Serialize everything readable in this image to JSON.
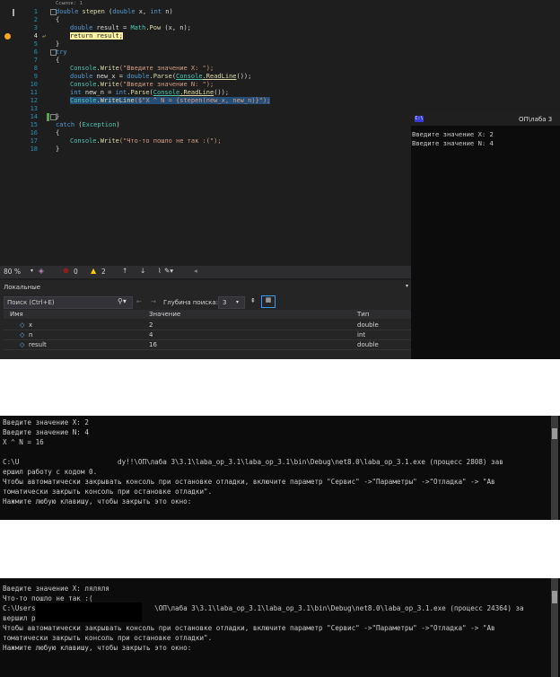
{
  "editor": {
    "codelens": "Ссылок: 1",
    "lines": [
      {
        "n": "1"
      },
      {
        "n": "2"
      },
      {
        "n": "3"
      },
      {
        "n": "4"
      },
      {
        "n": "5"
      },
      {
        "n": "6"
      },
      {
        "n": "7"
      },
      {
        "n": "8"
      },
      {
        "n": "9"
      },
      {
        "n": "10"
      },
      {
        "n": "11"
      },
      {
        "n": "12"
      },
      {
        "n": "13"
      },
      {
        "n": "14"
      },
      {
        "n": "15"
      },
      {
        "n": "16"
      },
      {
        "n": "17"
      },
      {
        "n": "18"
      }
    ],
    "code": {
      "l1_kw": "double",
      "l1_fn": "stepen",
      "l1_rest": " (",
      "l1_kw2": "double",
      "l1_p1": " x, ",
      "l1_kw3": "int",
      "l1_p2": " n)",
      "l2": "{",
      "l3_kw": "double",
      "l3_rest": " result = ",
      "l3_ty": "Math",
      "l3_fn": ".Pow",
      "l3_end": " (x, n);",
      "l4": "return result;",
      "l5": "}",
      "l6": "try",
      "l7": "{",
      "l8_ty": "Console",
      "l8_fn": ".Write",
      "l8_str": "(\"Введите значение X: \");",
      "l9_kw": "double",
      "l9_rest": " new_x = ",
      "l9_kw2": "double",
      "l9_fn": ".Parse",
      "l9_open": "(",
      "l9_ty": "Console",
      "l9_fn2": ".ReadLine",
      "l9_end": "());",
      "l10_ty": "Console",
      "l10_fn": ".Write",
      "l10_str": "(\"Введите значение N: \");",
      "l11_kw": "int",
      "l11_rest": " new_n = ",
      "l11_kw2": "int",
      "l11_fn": ".Parse",
      "l11_open": "(",
      "l11_ty": "Console",
      "l11_fn2": ".ReadLine",
      "l11_end": "());",
      "l12_ty": "Console",
      "l12_fn": ".WriteLine",
      "l12_str": "($\"X ^ N = {stepen(new_x, new_n)}\");",
      "l13": "",
      "l14": "}",
      "l15_kw": "catch",
      "l15_rest": " (",
      "l15_ty": "Exception",
      "l15_end": ")",
      "l16": "{",
      "l17_ty": "Console",
      "l17_fn": ".Write",
      "l17_str": "(\"Что-то пошло не так :(\");",
      "l18": "}"
    },
    "breakpoint_line": "4"
  },
  "statusbar": {
    "zoom": "80 %",
    "errors": "0",
    "warnings": "2"
  },
  "locals": {
    "title": "Локальные",
    "search_placeholder": "Поиск (Ctrl+E)",
    "depth_label": "Глубина поиска:",
    "depth_value": "3",
    "columns": [
      "Имя",
      "Значение",
      "Тип"
    ],
    "rows": [
      {
        "name": "x",
        "value": "2",
        "type": "double"
      },
      {
        "name": "n",
        "value": "4",
        "type": "int"
      },
      {
        "name": "result",
        "value": "16",
        "type": "double"
      }
    ]
  },
  "vs_console": {
    "title": "ОП\\лаба 3",
    "lines": [
      "Введите значение X: 2",
      "Введите значение N: 4"
    ]
  },
  "terminal2": {
    "lines": [
      "Введите значение X: 2",
      "Введите значение N: 4",
      "X ^ N = 16",
      "",
      "C:\\U                        dy!!\\ОП\\лаба 3\\3.1\\laba_op_3.1\\laba_op_3.1\\bin\\Debug\\net8.0\\laba_op_3.1.exe (процесс 2808) зав",
      "ершил работу с кодом 0.",
      "Чтобы автоматически закрывать консоль при остановке отладки, включите параметр \"Сервис\" ->\"Параметры\" ->\"Отладка\" -> \"Ав",
      "томатически закрыть консоль при остановке отладки\".",
      "Нажмите любую клавишу, чтобы закрыть это окно:"
    ]
  },
  "terminal3": {
    "lines": [
      "Введите значение X: ляляля",
      "Что-то пошло не так :(",
      "C:\\Users'                            \\ОП\\лаба 3\\3.1\\laba_op_3.1\\laba_op_3.1\\bin\\Debug\\net8.0\\laba_op_3.1.exe (процесс 24364) за",
      "вершил работу с кодом 0.",
      "Чтобы автоматически закрывать консоль при остановке отладки, включите параметр \"Сервис\" ->\"Параметры\" ->\"Отладка\" -> \"Ав",
      "томатически закрыть консоль при остановке отладки\".",
      "Нажмите любую клавишу, чтобы закрыть это окно:"
    ]
  }
}
